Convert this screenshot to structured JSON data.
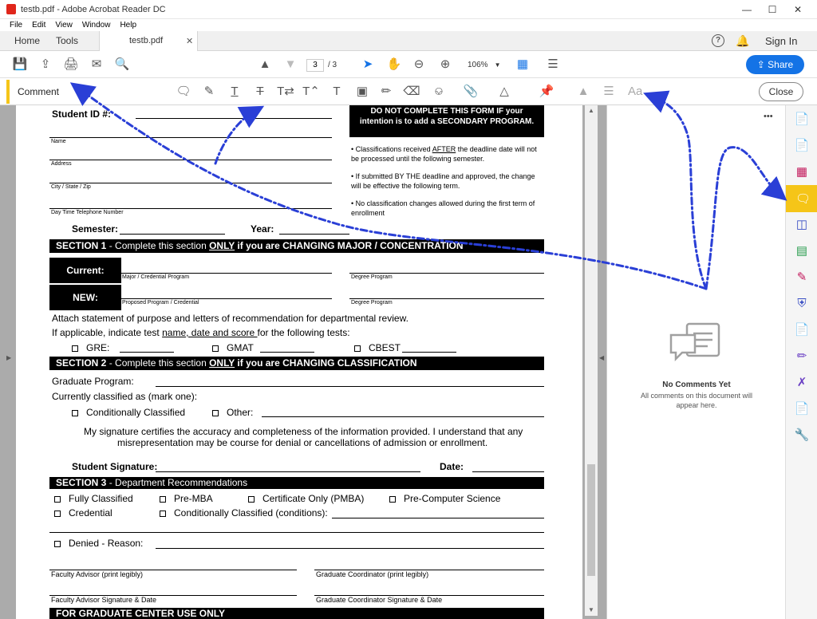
{
  "window": {
    "title": "testb.pdf - Adobe Acrobat Reader DC",
    "menu": [
      "File",
      "Edit",
      "View",
      "Window",
      "Help"
    ]
  },
  "tabs": {
    "home": "Home",
    "tools": "Tools",
    "doc": "testb.pdf",
    "signin": "Sign In"
  },
  "toolbar": {
    "page_current": "3",
    "page_sep": "/ 3",
    "zoom": "106%",
    "share": "Share"
  },
  "commentbar": {
    "label": "Comment",
    "close": "Close",
    "font_label": "Aa"
  },
  "panel": {
    "more": "•••",
    "empty_title": "No Comments Yet",
    "empty_body": "All comments on this document will appear here."
  },
  "form": {
    "student_id": "Student ID #:",
    "name": "Name",
    "address": "Address",
    "city": "City / State / Zip",
    "phone": "Day Time Telephone Number",
    "semester": "Semester:",
    "year": "Year:",
    "warn": "DO NOT COMPLETE THIS FORM IF your intention is to add a SECONDARY PROGRAM.",
    "note1a": "• Classifications received ",
    "note1b": "AFTER",
    "note1c": " the deadline date will not be processed until the following semester.",
    "note2": "• If submitted BY THE deadline and approved, the change will be effective the following term.",
    "note3": "• No classification changes allowed during the first term of enrollment",
    "s1a": "SECTION 1",
    " s1b": "",
    "s1_pre": " - Complete this section ",
    "s1_only": "ONLY",
    "s1_post": " if you are CHANGING MAJOR / CONCENTRATION",
    "current": "Current:",
    "new": "NEW:",
    "major_prog": "Major / Credential Program",
    "degree_prog": "Degree Program",
    "proposed": "Proposed Program / Credential",
    "degree_prog2": "Degree Program",
    "attach": "Attach statement of purpose and letters of recommendation for departmental review.",
    "ifapp_a": "If applicable, indicate test ",
    "ifapp_b": "name, date and score ",
    "ifapp_c": "for the following tests:",
    "gre": "GRE:",
    "gmat": "GMAT",
    "cbest": "CBEST",
    "s2a": "SECTION 2",
    "s2_pre": " - Complete this section ",
    "s2_only": "ONLY",
    "s2_post": " if you are CHANGING CLASSIFICATION",
    "grad_prog": "Graduate Program:",
    "curr_class": "Currently classified as (mark one):",
    "cond": "Conditionally Classified",
    "other": "Other:",
    "certify1": "My signature certifies the accuracy and completeness of the information provided.  I understand that any",
    "certify2": "misrepresentation may be course for denial or cancellations of admission or enrollment.",
    "student_sig": "Student Signature:",
    "date": "Date:",
    "s3a": "SECTION 3",
    "s3_post": " - Department Recommendations",
    "fully": "Fully Classified",
    "premba": "Pre-MBA",
    "certonly": "Certificate Only (PMBA)",
    "precs": "Pre-Computer Science",
    "credential": "Credential",
    "cond2": "Conditionally Classified (conditions):",
    "denied": "Denied - Reason:",
    "fac_adv": "Faculty Advisor (print legibly)",
    "grad_coord": "Graduate Coordinator (print legibly)",
    "fac_sig": "Faculty Advisor Signature & Date",
    "grad_sig": "Graduate Coordinator Signature & Date",
    "grad_center": "FOR GRADUATE CENTER USE ONLY"
  },
  "colors": {
    "accent": "#1473e6",
    "comment_yellow": "#f5c518",
    "arrow": "#2a3fd6"
  }
}
